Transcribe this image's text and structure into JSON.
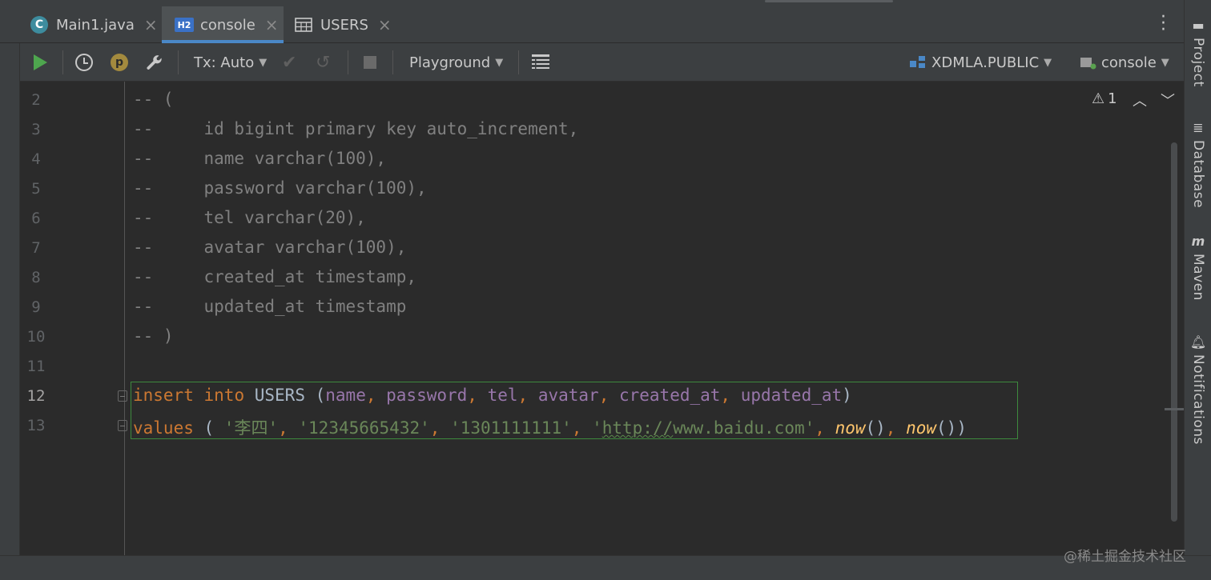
{
  "tabs": [
    {
      "label": "Main1.java",
      "icon": "java-class-icon",
      "active": false
    },
    {
      "label": "console",
      "icon": "h2-console-icon",
      "icon_text": "H2",
      "active": true
    },
    {
      "label": "USERS",
      "icon": "table-icon",
      "active": false
    }
  ],
  "toolbar": {
    "tx_label": "Tx: Auto",
    "playground_label": "Playground",
    "schema_label": "XDMLA.PUBLIC",
    "session_label": "console",
    "p_badge": "p"
  },
  "editor": {
    "warning_count": "1",
    "current_line": "12",
    "lines": [
      {
        "num": "2",
        "text": "-- ("
      },
      {
        "num": "3",
        "text": "--     id bigint primary key auto_increment,"
      },
      {
        "num": "4",
        "text": "--     name varchar(100),"
      },
      {
        "num": "5",
        "text": "--     password varchar(100),"
      },
      {
        "num": "6",
        "text": "--     tel varchar(20),"
      },
      {
        "num": "7",
        "text": "--     avatar varchar(100),"
      },
      {
        "num": "8",
        "text": "--     created_at timestamp,"
      },
      {
        "num": "9",
        "text": "--     updated_at timestamp"
      },
      {
        "num": "10",
        "text": "-- )"
      },
      {
        "num": "11",
        "text": ""
      },
      {
        "num": "12",
        "text": ""
      },
      {
        "num": "13",
        "text": ""
      }
    ],
    "insert": {
      "kw_insert": "insert",
      "kw_into": "into",
      "table": "USERS",
      "open": " (",
      "columns": [
        "name",
        "password",
        "tel",
        "avatar",
        "created_at",
        "updated_at"
      ],
      "sep": ", ",
      "close": ")"
    },
    "values": {
      "kw_values": "values",
      "open": " ( ",
      "v1": "'李四'",
      "v2": "'12345665432'",
      "v3": "'1301111111'",
      "v4_q": "'",
      "v4_sq": "http://",
      "v4_rest": "www.baidu.com'",
      "fn": "now",
      "parens": "()",
      "sep": ", ",
      "close": ")"
    }
  },
  "right_tools": [
    "Project",
    "Database",
    "Maven",
    "Notifications"
  ],
  "watermark": "@稀土掘金技术社区",
  "colors": {
    "keyword": "#cc7832",
    "column": "#9876aa",
    "string": "#6a8759",
    "function": "#ffc66d",
    "comment": "#808080",
    "active_tab_underline": "#4a88c7"
  }
}
